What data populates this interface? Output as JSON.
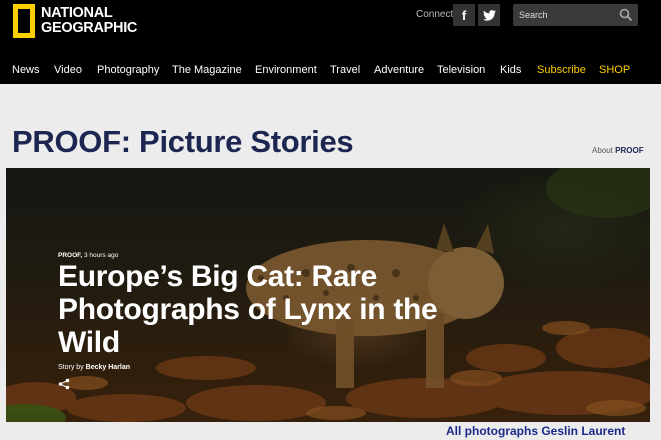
{
  "brand": {
    "line1": "NATIONAL",
    "line2": "GEOGRAPHIC",
    "color": "#ffce00"
  },
  "header": {
    "connect_label": "Connect:",
    "social": [
      {
        "name": "facebook",
        "glyph": "f"
      },
      {
        "name": "twitter",
        "glyph": "twitter-icon"
      }
    ],
    "search": {
      "placeholder": "Search"
    }
  },
  "nav": {
    "items": [
      "News",
      "Video",
      "Photography",
      "The Magazine",
      "Environment",
      "Travel",
      "Adventure",
      "Television",
      "Kids",
      "Subscribe",
      "SHOP"
    ],
    "accent_color": "#ffcc00"
  },
  "page": {
    "title": "PROOF: Picture Stories",
    "about_prefix": "About",
    "about_link": "PROOF"
  },
  "hero": {
    "section": "PROOF,",
    "time": "3 hours ago",
    "title": "Europe’s Big Cat: Rare Photographs of Lynx in the Wild",
    "story_by_prefix": "Story by",
    "author": "Becky Harlan"
  },
  "caption": "All photographs Geslin Laurent"
}
